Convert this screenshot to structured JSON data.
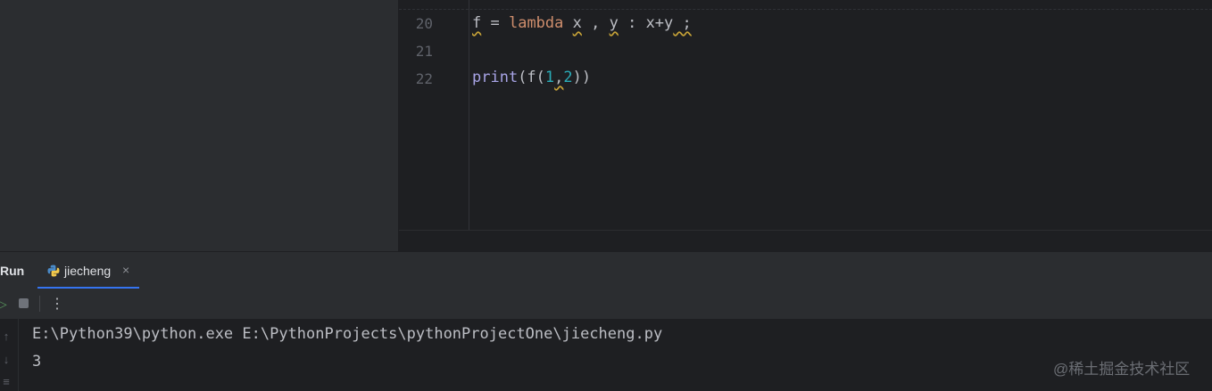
{
  "editor": {
    "line_numbers": [
      "20",
      "21",
      "22"
    ],
    "line20": {
      "t1": "f",
      "t2": " = ",
      "t3": "lambda",
      "t4": " ",
      "t5": "x",
      "t6": " , ",
      "t7": "y",
      "t8": " : x+",
      "t9": "y",
      "t10": " ;"
    },
    "line22": {
      "t1": "print",
      "t2": "(f(",
      "t3": "1",
      "t4": ",",
      "t5": "2",
      "t6": "))"
    }
  },
  "run_panel": {
    "title": "Run",
    "tab_label": "jiecheng",
    "close_glyph": "×",
    "more_glyph": "⋮"
  },
  "console": {
    "lines": [
      "E:\\Python39\\python.exe E:\\PythonProjects\\pythonProjectOne\\jiecheng.py",
      "3"
    ]
  },
  "watermark": "@稀土掘金技术社区",
  "colors": {
    "keyword": "#cf8e6d",
    "function": "#a8a4e6",
    "number": "#2aacb8",
    "accent": "#3574f0",
    "run_green": "#57965c"
  },
  "icons": [
    "python-file-icon",
    "rerun-icon",
    "stop-icon",
    "more-icon",
    "scroll-up-icon",
    "scroll-down-icon",
    "soft-wrap-icon"
  ]
}
